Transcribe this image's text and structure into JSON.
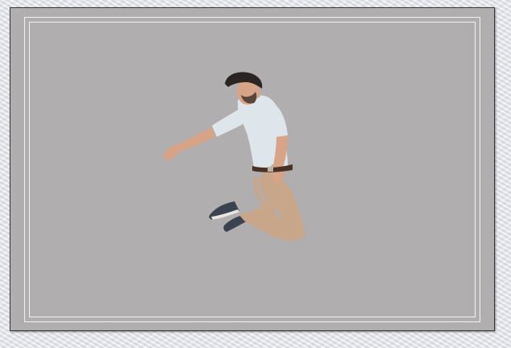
{
  "photo": {
    "subject": "jumping-man-photo",
    "colors": {
      "background": "#b0aeaf",
      "frame_border": "#3a3a3c",
      "inner_border": "#f2f2f4",
      "shirt": "#dfe6eb",
      "pants": "#c8a68a",
      "shoes": "#3b4250",
      "hair": "#2a2522",
      "skin": "#d7a487",
      "belt": "#4a3126",
      "page_background": "#e4e5ea"
    }
  }
}
